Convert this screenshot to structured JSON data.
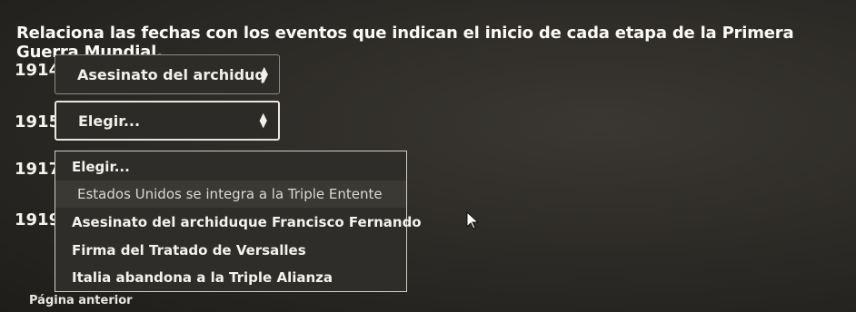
{
  "title": "Relaciona las fechas con los eventos que indican el inicio de cada etapa de la Primera Guerra Mundial.",
  "rows": [
    {
      "year": "1914",
      "selected": "Asesinato del archiduq"
    },
    {
      "year": "1915",
      "selected": "Elegir..."
    },
    {
      "year": "1917"
    },
    {
      "year": "1919"
    }
  ],
  "dropdown": {
    "options": [
      "Elegir...",
      "Estados Unidos se integra a la Triple Entente",
      "Asesinato del archiduque Francisco Fernando",
      "Firma del Tratado de Versalles",
      "Italia abandona a la Triple Alianza"
    ],
    "highlighted_index": 1
  },
  "nav": {
    "previous_page": "Página anterior"
  }
}
